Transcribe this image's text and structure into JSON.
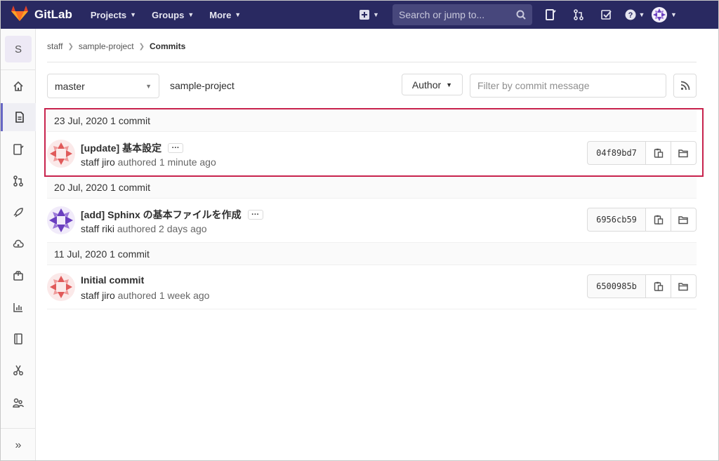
{
  "navbar": {
    "brand": "GitLab",
    "menu": [
      {
        "label": "Projects"
      },
      {
        "label": "Groups"
      },
      {
        "label": "More"
      }
    ],
    "search_placeholder": "Search or jump to...",
    "icons": [
      "plus-square-icon",
      "issues-icon",
      "merge-request-icon",
      "todo-icon",
      "help-icon",
      "user-avatar"
    ]
  },
  "sidebar": {
    "project_initial": "S",
    "items": [
      "home-icon",
      "repository-icon",
      "issues-icon",
      "merge-requests-icon",
      "ci-cd-icon",
      "operations-icon",
      "packages-icon",
      "analytics-icon",
      "wiki-icon",
      "snippets-icon",
      "members-icon"
    ],
    "collapse_icon": "double-chevron-right-icon"
  },
  "breadcrumb": {
    "items": [
      "staff",
      "sample-project"
    ],
    "current": "Commits"
  },
  "toolbar": {
    "branch": "master",
    "project_name": "sample-project",
    "author_label": "Author",
    "filter_placeholder": "Filter by commit message"
  },
  "commit_groups": [
    {
      "date": "23 Jul, 2020 1 commit",
      "commits": [
        {
          "title": "[update] 基本設定",
          "author": "staff jiro",
          "time": "authored 1 minute ago",
          "sha": "04f89bd7",
          "has_more": true
        }
      ]
    },
    {
      "date": "20 Jul, 2020 1 commit",
      "commits": [
        {
          "title": "[add] Sphinx の基本ファイルを作成",
          "author": "staff riki",
          "time": "authored 2 days ago",
          "sha": "6956cb59",
          "has_more": true
        }
      ]
    },
    {
      "date": "11 Jul, 2020 1 commit",
      "commits": [
        {
          "title": "Initial commit",
          "author": "staff jiro",
          "time": "authored 1 week ago",
          "sha": "6500985b",
          "has_more": false
        }
      ]
    }
  ],
  "colors": {
    "navbar": "#292961",
    "highlight": "#c8234d",
    "avatar_red": "#e05a5a",
    "avatar_purple": "#6a3fbf"
  }
}
